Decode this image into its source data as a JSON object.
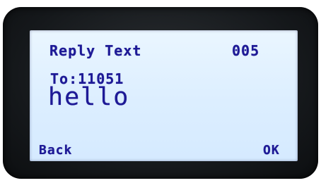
{
  "screen": {
    "title": "Reply Text",
    "counter": "005",
    "recipient": "To:11051",
    "message": "hello"
  },
  "softkeys": {
    "left": "Back",
    "right": "OK"
  },
  "colors": {
    "lcd_text": "#1e1a96",
    "lcd_background": "#dceeff",
    "bezel": "#15181b"
  }
}
